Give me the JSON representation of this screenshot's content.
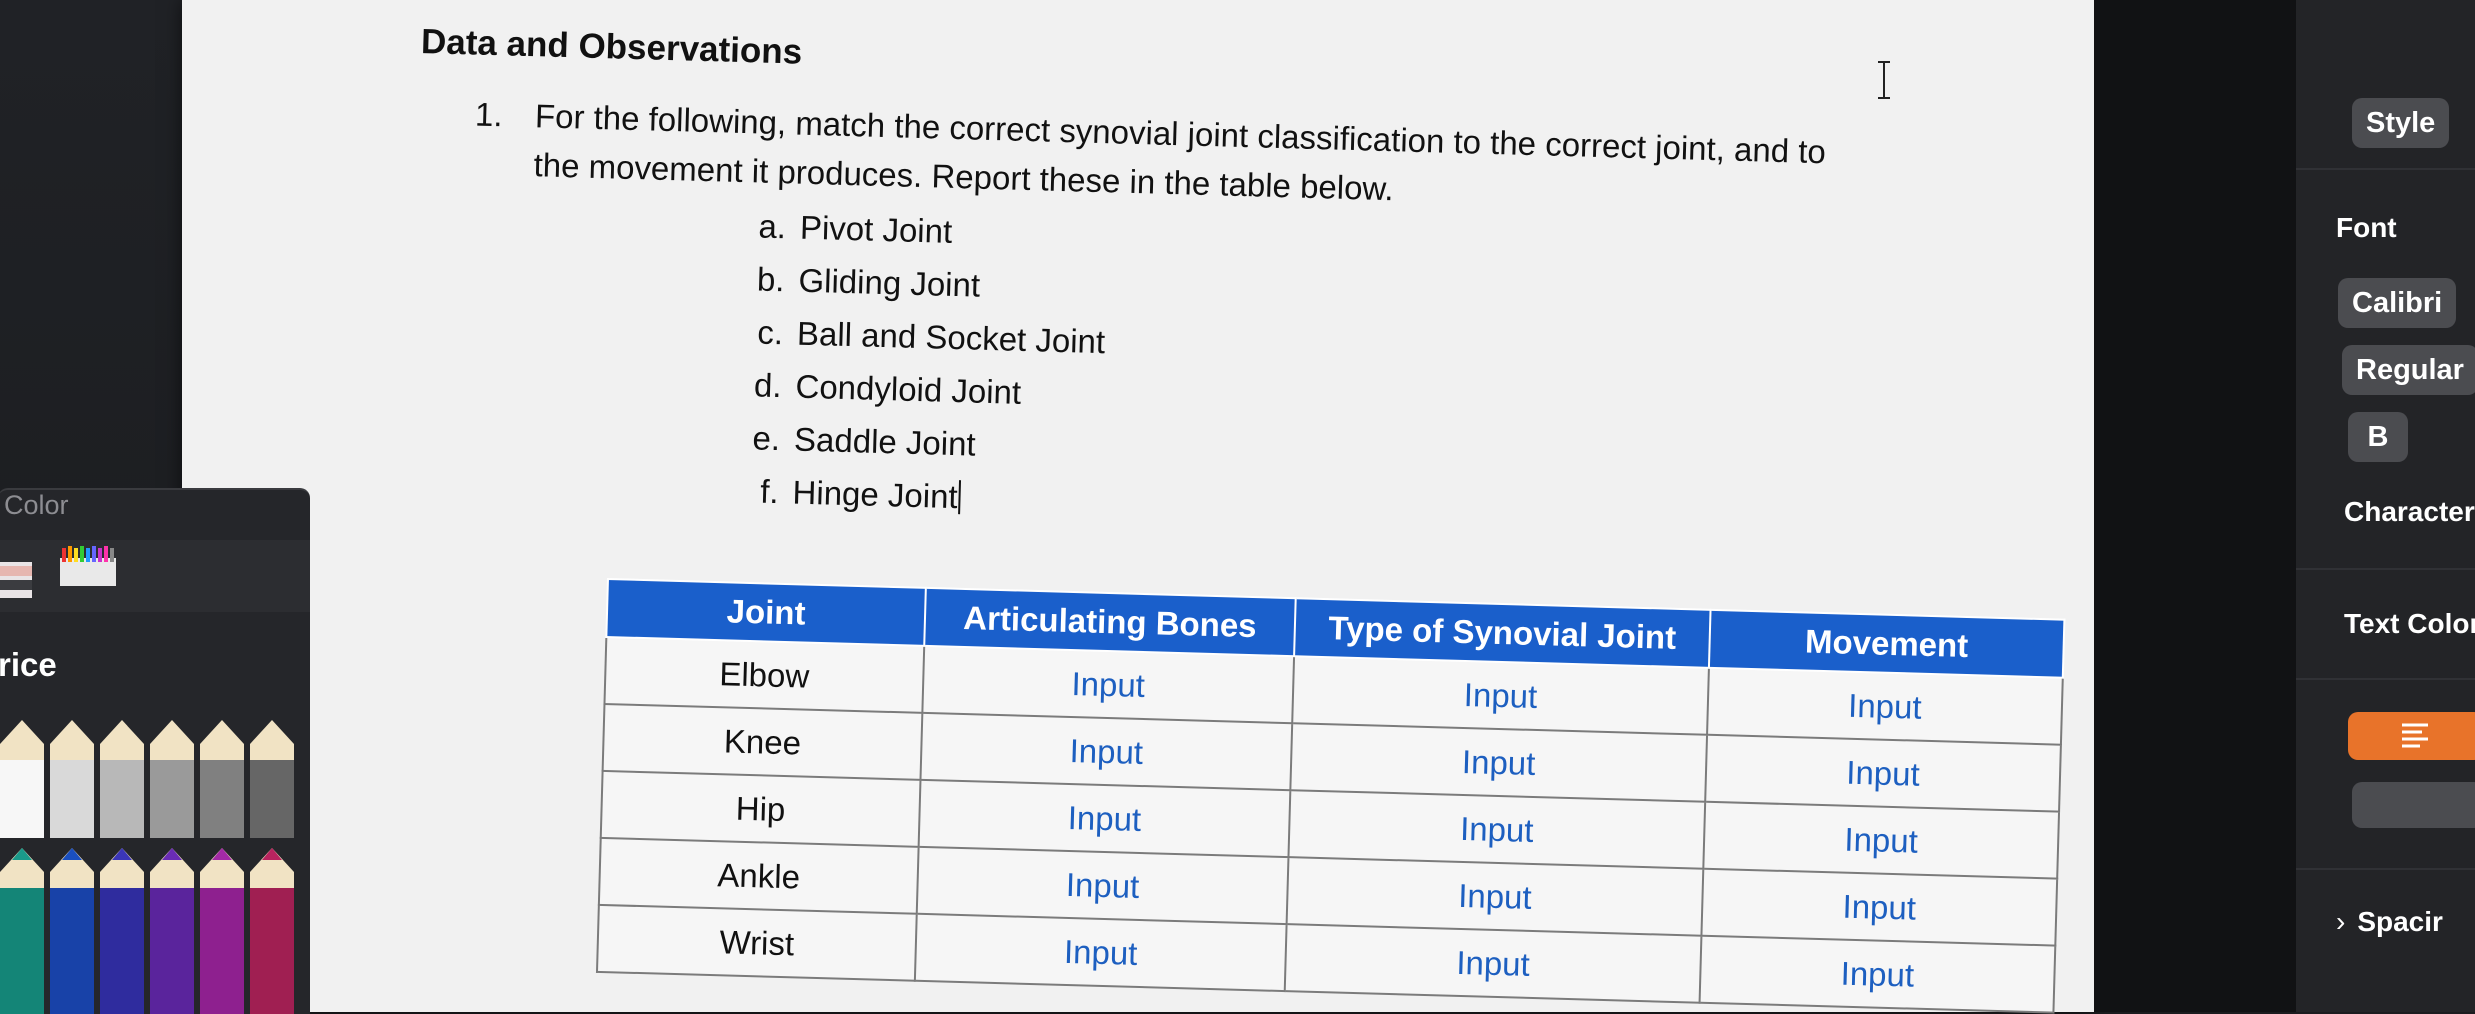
{
  "document": {
    "heading": "Data and Observations",
    "question": {
      "number": "1.",
      "text": "For the following, match the correct synovial joint classification to the correct joint, and to the movement it produces. Report these in the table below."
    },
    "options": [
      {
        "letter": "a.",
        "label": "Pivot Joint"
      },
      {
        "letter": "b.",
        "label": "Gliding Joint"
      },
      {
        "letter": "c.",
        "label": "Ball and Socket Joint"
      },
      {
        "letter": "d.",
        "label": "Condyloid Joint"
      },
      {
        "letter": "e.",
        "label": "Saddle Joint"
      },
      {
        "letter": "f.",
        "label": "Hinge Joint"
      }
    ],
    "table": {
      "headers": [
        "Joint",
        "Articulating Bones",
        "Type of Synovial Joint",
        "Movement"
      ],
      "rows": [
        [
          "Elbow",
          "Input",
          "Input",
          "Input"
        ],
        [
          "Knee",
          "Input",
          "Input",
          "Input"
        ],
        [
          "Hip",
          "Input",
          "Input",
          "Input"
        ],
        [
          "Ankle",
          "Input",
          "Input",
          "Input"
        ],
        [
          "Wrist",
          "Input",
          "Input",
          "Input"
        ]
      ],
      "header_color": "#1a5fcb",
      "input_color": "#1d5fc0"
    }
  },
  "color_panel": {
    "title": "Color",
    "price_label": "rice"
  },
  "inspector": {
    "style_button": "Style",
    "font_label": "Font",
    "font_family": "Calibri",
    "font_style": "Regular",
    "bold_button": "B",
    "character_label": "Character",
    "text_color_label": "Text Color",
    "spacing_label": "Spacir",
    "accent": "#e8732a"
  }
}
